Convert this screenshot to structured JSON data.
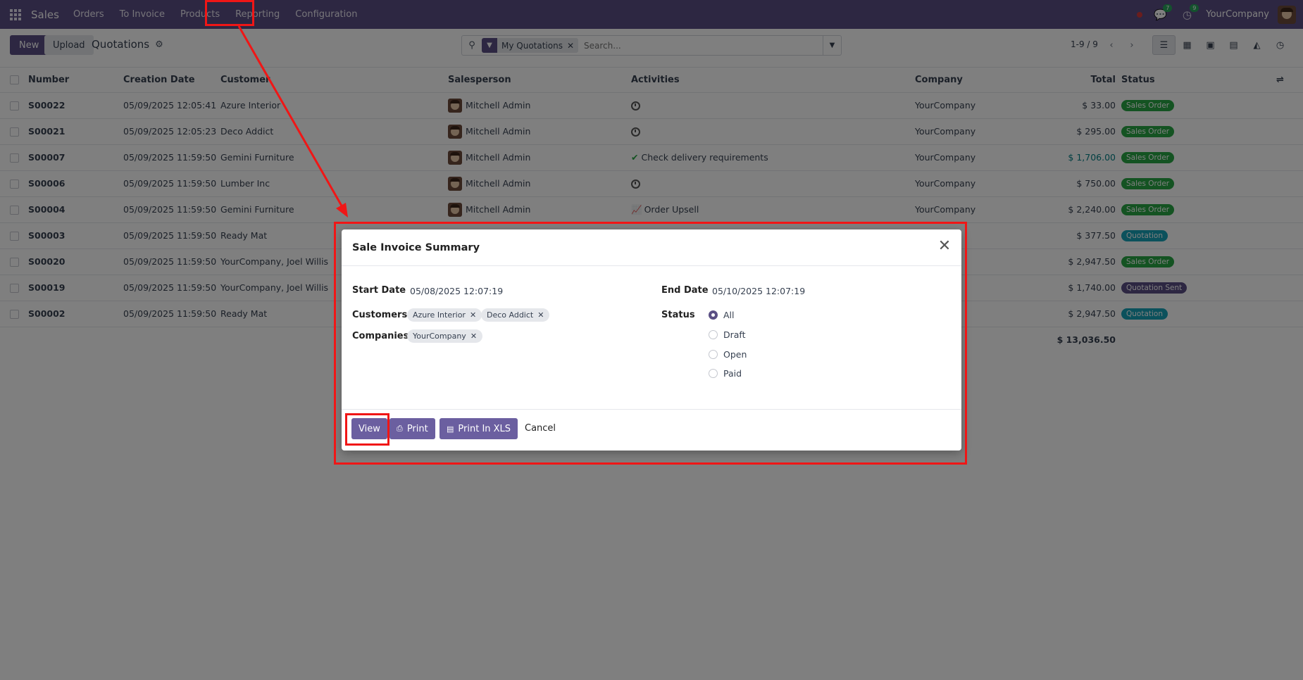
{
  "navbar": {
    "app_name": "Sales",
    "menu": [
      "Orders",
      "To Invoice",
      "Products",
      "Reporting",
      "Configuration"
    ],
    "messages_count": "7",
    "activities_count": "9",
    "company": "YourCompany"
  },
  "control": {
    "new_label": "New",
    "upload_label": "Upload",
    "breadcrumb": "Quotations",
    "facet_label": "My Quotations",
    "search_placeholder": "Search...",
    "pager": "1-9 / 9"
  },
  "table": {
    "headers": [
      "Number",
      "Creation Date",
      "Customer",
      "Salesperson",
      "Activities",
      "Company",
      "Total",
      "Status"
    ],
    "rows": [
      {
        "number": "S00022",
        "date": "05/09/2025 12:05:41",
        "customer": "Azure Interior",
        "salesperson": "Mitchell Admin",
        "activity": "",
        "activity_icon": "clock-icon",
        "company": "YourCompany",
        "total": "$ 33.00",
        "status": "Sales Order"
      },
      {
        "number": "S00021",
        "date": "05/09/2025 12:05:23",
        "customer": "Deco Addict",
        "salesperson": "Mitchell Admin",
        "activity": "",
        "activity_icon": "clock-icon",
        "company": "YourCompany",
        "total": "$ 295.00",
        "status": "Sales Order"
      },
      {
        "number": "S00007",
        "date": "05/09/2025 11:59:50",
        "customer": "Gemini Furniture",
        "salesperson": "Mitchell Admin",
        "activity": "Check delivery requirements",
        "activity_icon": "check-icon",
        "company": "YourCompany",
        "total": "$ 1,706.00",
        "status": "Sales Order"
      },
      {
        "number": "S00006",
        "date": "05/09/2025 11:59:50",
        "customer": "Lumber Inc",
        "salesperson": "Mitchell Admin",
        "activity": "",
        "activity_icon": "clock-icon",
        "company": "YourCompany",
        "total": "$ 750.00",
        "status": "Sales Order"
      },
      {
        "number": "S00004",
        "date": "05/09/2025 11:59:50",
        "customer": "Gemini Furniture",
        "salesperson": "Mitchell Admin",
        "activity": "Order Upsell",
        "activity_icon": "chart-icon",
        "company": "YourCompany",
        "total": "$ 2,240.00",
        "status": "Sales Order"
      },
      {
        "number": "S00003",
        "date": "05/09/2025 11:59:50",
        "customer": "Ready Mat",
        "salesperson": "",
        "activity": "",
        "activity_icon": "",
        "company": "y",
        "total": "$ 377.50",
        "status": "Quotation"
      },
      {
        "number": "S00020",
        "date": "05/09/2025 11:59:50",
        "customer": "YourCompany, Joel Willis",
        "salesperson": "",
        "activity": "",
        "activity_icon": "",
        "company": "y",
        "total": "$ 2,947.50",
        "status": "Sales Order"
      },
      {
        "number": "S00019",
        "date": "05/09/2025 11:59:50",
        "customer": "YourCompany, Joel Willis",
        "salesperson": "",
        "activity": "",
        "activity_icon": "",
        "company": "y",
        "total": "$ 1,740.00",
        "status": "Quotation Sent"
      },
      {
        "number": "S00002",
        "date": "05/09/2025 11:59:50",
        "customer": "Ready Mat",
        "salesperson": "",
        "activity": "",
        "activity_icon": "",
        "company": "y",
        "total": "$ 2,947.50",
        "status": "Quotation"
      }
    ],
    "grand_total": "$ 13,036.50"
  },
  "dialog": {
    "title": "Sale Invoice Summary",
    "start_date_label": "Start Date",
    "start_date": "05/08/2025 12:07:19",
    "end_date_label": "End Date",
    "end_date": "05/10/2025 12:07:19",
    "customers_label": "Customers",
    "customers": [
      "Azure Interior",
      "Deco Addict"
    ],
    "companies_label": "Companies",
    "companies": [
      "YourCompany"
    ],
    "status_label": "Status",
    "status_options": [
      "All",
      "Draft",
      "Open",
      "Paid"
    ],
    "status_selected": "All",
    "view_label": "View",
    "print_label": "Print",
    "print_xls_label": "Print In XLS",
    "cancel_label": "Cancel"
  },
  "colors": {
    "brand": "#5b4f84",
    "sales_order": "#28a745",
    "quotation": "#17a2b8",
    "quotation_sent": "#5b4f84",
    "annotation": "#f01616"
  }
}
